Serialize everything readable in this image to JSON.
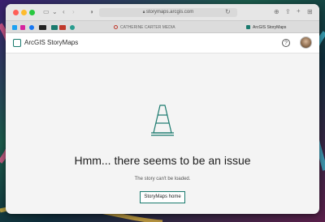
{
  "browser": {
    "url": "storymaps.arcgis.com",
    "tabs": [
      {
        "label": "CATHERINE CARTER MEDIA"
      },
      {
        "label": "ArcGIS StoryMaps"
      }
    ]
  },
  "app": {
    "brand": "ArcGIS StoryMaps",
    "help_label": "?"
  },
  "error": {
    "heading": "Hmm... there seems to be an issue",
    "message": "The story can't be loaded.",
    "button_label": "StoryMaps home"
  },
  "colors": {
    "accent": "#1a7a6e"
  }
}
